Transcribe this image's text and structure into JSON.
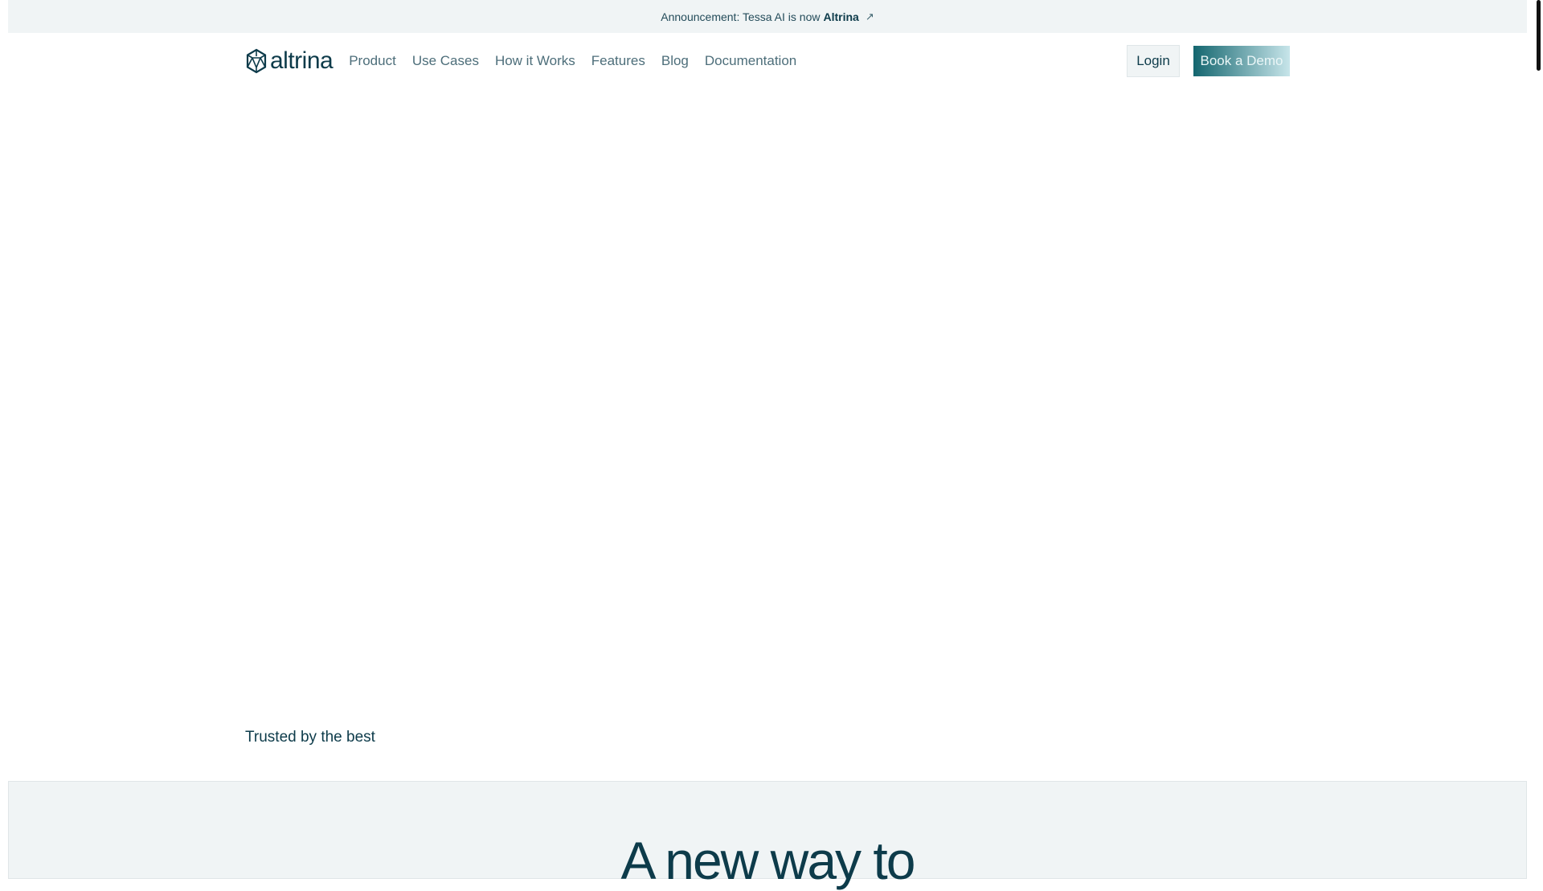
{
  "announcement": {
    "prefix": "Announcement: Tessa AI is now",
    "brand": "Altrina",
    "arrow_icon": "arrow-up-right-icon"
  },
  "logo": {
    "text": "altrina"
  },
  "nav": {
    "items": [
      "Product",
      "Use Cases",
      "How it Works",
      "Features",
      "Blog",
      "Documentation"
    ]
  },
  "actions": {
    "login": "Login",
    "book_demo": "Book a Demo"
  },
  "trusted": {
    "label": "Trusted by the best"
  },
  "section": {
    "heading": "A new way to"
  },
  "colors": {
    "brand": "#0d3b4a",
    "accent_start": "#14666f",
    "accent_end": "#c7e5ea",
    "muted_bg": "#f0f4f5"
  }
}
